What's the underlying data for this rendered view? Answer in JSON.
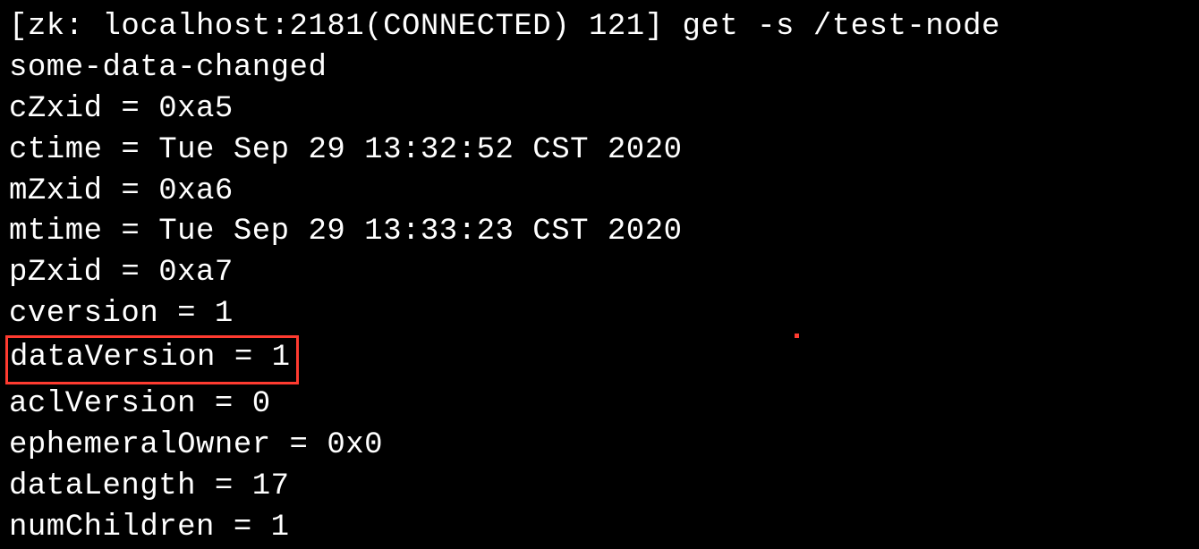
{
  "terminal": {
    "prompt": "[zk: localhost:2181(CONNECTED) 121] get -s /test-node",
    "data": "some-data-changed",
    "stats": {
      "cZxid": "cZxid = 0xa5",
      "ctime": "ctime = Tue Sep 29 13:32:52 CST 2020",
      "mZxid": "mZxid = 0xa6",
      "mtime": "mtime = Tue Sep 29 13:33:23 CST 2020",
      "pZxid": "pZxid = 0xa7",
      "cversion": "cversion = 1",
      "dataVersion": "dataVersion = 1",
      "aclVersion": "aclVersion = 0",
      "ephemeralOwner": "ephemeralOwner = 0x0",
      "dataLength": "dataLength = 17",
      "numChildren": "numChildren = 1"
    }
  }
}
